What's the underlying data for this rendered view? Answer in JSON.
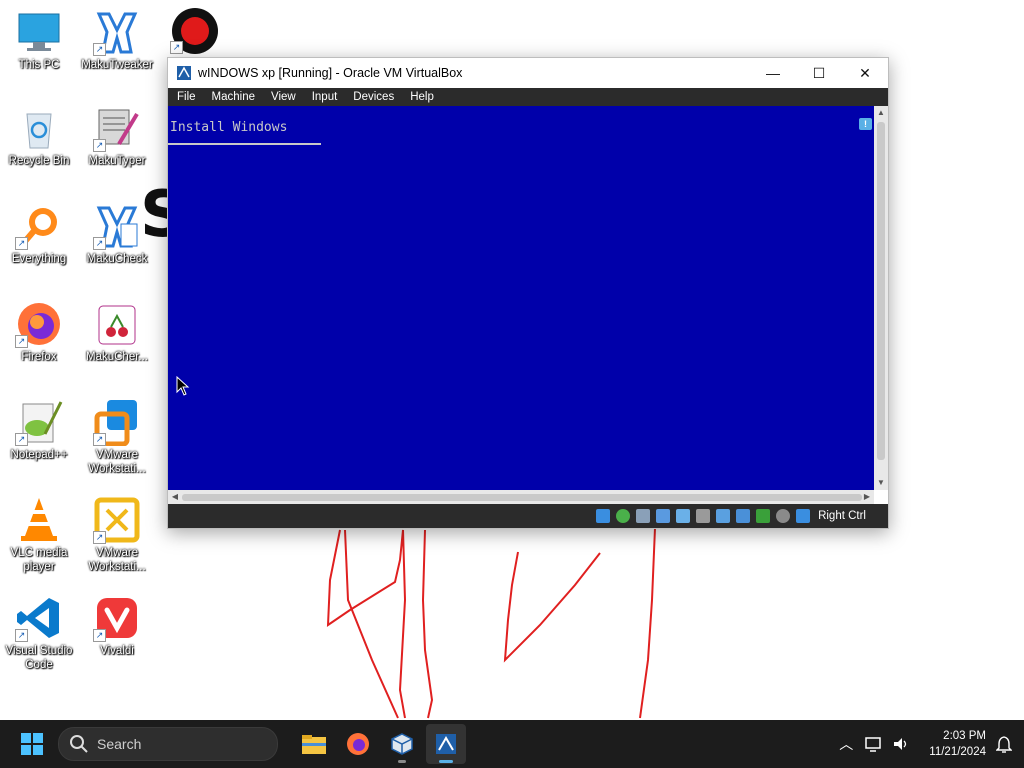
{
  "desktop": {
    "icons": [
      {
        "label": "This PC"
      },
      {
        "label": "MakuTweaker"
      },
      {
        "label": "Recycle Bin"
      },
      {
        "label": "MakuTyper"
      },
      {
        "label": "Everything"
      },
      {
        "label": "MakuCheck"
      },
      {
        "label": "Firefox"
      },
      {
        "label": "MakuCher..."
      },
      {
        "label": "Notepad++"
      },
      {
        "label": "VMware Workstati..."
      },
      {
        "label": "VLC media player"
      },
      {
        "label": "VMware Workstati..."
      },
      {
        "label": "Visual Studio Code"
      },
      {
        "label": "Vivaldi"
      }
    ],
    "background_letter": "S"
  },
  "window": {
    "title": "wINDOWS xp [Running] - Oracle VM VirtualBox",
    "minimize": "—",
    "maximize": "☐",
    "close": "✕",
    "menu": [
      "File",
      "Machine",
      "View",
      "Input",
      "Devices",
      "Help"
    ],
    "vm_screen": {
      "header": "Install Windows",
      "background": "#0000aa"
    },
    "status": {
      "host_key": "Right Ctrl"
    }
  },
  "taskbar": {
    "search_placeholder": "Search",
    "clock_time": "2:03 PM",
    "clock_date": "11/21/2024"
  },
  "colors": {
    "vm_blue": "#0000aa",
    "taskbar": "#1c1c1c",
    "scribble": "#e02020"
  }
}
